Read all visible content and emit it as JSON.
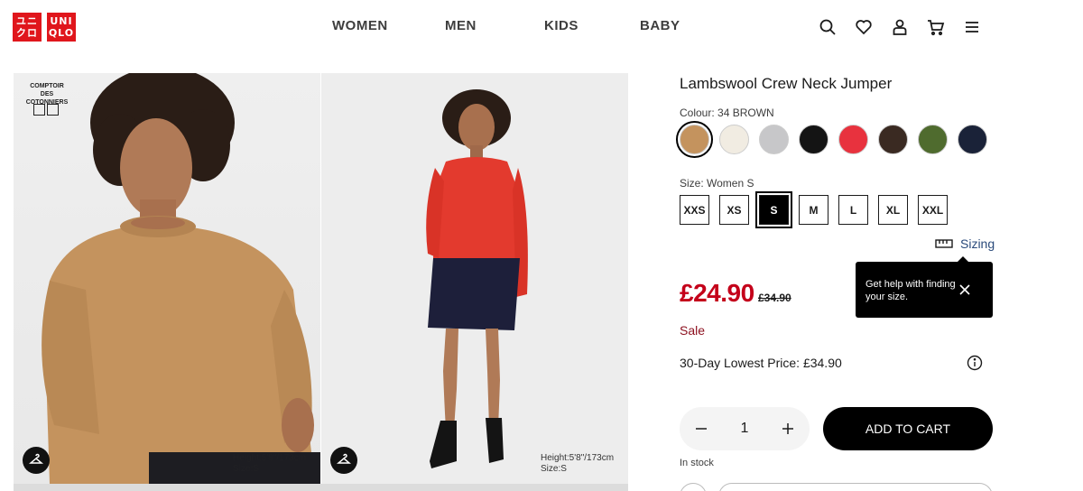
{
  "header": {
    "logo": {
      "top_left": "ユニ",
      "top_right": "UNI",
      "bottom_left": "クロ",
      "bottom_right": "QLO"
    },
    "nav": [
      "WOMEN",
      "MEN",
      "KIDS",
      "BABY"
    ],
    "icons": [
      "search-icon",
      "heart-icon",
      "account-icon",
      "cart-icon",
      "menu-icon"
    ]
  },
  "gallery": {
    "image1": {
      "brand_tag": "COMPTOIR DES COTONNIERS",
      "caption": "Height:5'8\"/173cm Size:S"
    },
    "image2": {
      "caption_height": "Height:5'8\"/173cm",
      "caption_size": "Size:S"
    }
  },
  "product": {
    "title": "Lambswool Crew Neck Jumper",
    "colour_label": "Colour: 34 BROWN",
    "colours": [
      {
        "name": "brown",
        "hex": "#c4935e",
        "selected": true
      },
      {
        "name": "off-white",
        "hex": "#f1ece2",
        "selected": false
      },
      {
        "name": "grey",
        "hex": "#c7c7c9",
        "selected": false
      },
      {
        "name": "black",
        "hex": "#141414",
        "selected": false
      },
      {
        "name": "red",
        "hex": "#e8323e",
        "selected": false
      },
      {
        "name": "dark-brown",
        "hex": "#3a2a22",
        "selected": false
      },
      {
        "name": "olive",
        "hex": "#4f6b2e",
        "selected": false
      },
      {
        "name": "navy",
        "hex": "#1a2238",
        "selected": false
      }
    ],
    "size_label": "Size: Women S",
    "sizes": [
      "XXS",
      "XS",
      "S",
      "M",
      "L",
      "XL",
      "XXL"
    ],
    "selected_size": "S",
    "sizing_link": "Sizing",
    "tooltip": "Get help with finding your size.",
    "price": "£24.90",
    "old_price": "£34.90",
    "sale": "Sale",
    "lowest_price": "30-Day Lowest Price: £34.90",
    "quantity": "1",
    "add_to_cart": "ADD TO CART",
    "stock": "In stock"
  },
  "colors": {
    "brand_red": "#e0161c",
    "price_red": "#c4001a",
    "sale_red": "#8c0f1e",
    "link_blue": "#2a4a7b"
  }
}
